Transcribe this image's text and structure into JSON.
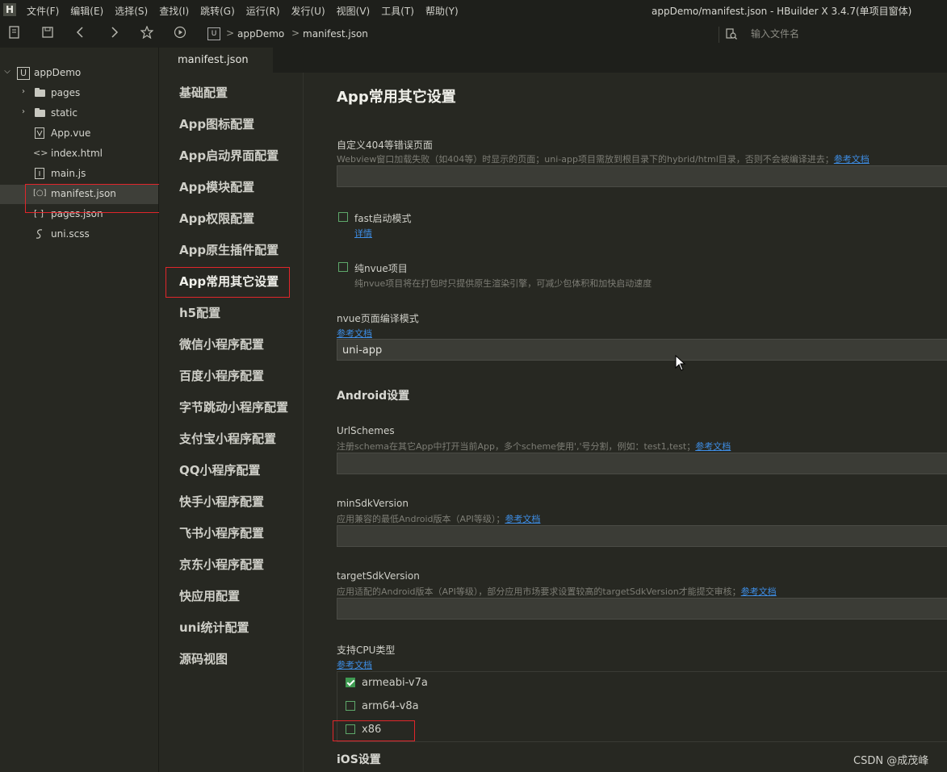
{
  "window": {
    "logo": "H",
    "title": "appDemo/manifest.json - HBuilder X 3.4.7(单项目窗体)"
  },
  "menu": [
    "文件(F)",
    "编辑(E)",
    "选择(S)",
    "查找(I)",
    "跳转(G)",
    "运行(R)",
    "发行(U)",
    "视图(V)",
    "工具(T)",
    "帮助(Y)"
  ],
  "toolbar": {
    "breadcrumb": {
      "badge": "U",
      "project": "appDemo",
      "separator": ">",
      "file": "manifest.json"
    },
    "file_search_placeholder": "输入文件名"
  },
  "tree": {
    "project": "appDemo",
    "items": [
      {
        "label": "pages",
        "type": "folder"
      },
      {
        "label": "static",
        "type": "folder"
      },
      {
        "label": "App.vue",
        "type": "vue"
      },
      {
        "label": "index.html",
        "type": "html"
      },
      {
        "label": "main.js",
        "type": "js"
      },
      {
        "label": "manifest.json",
        "type": "json",
        "selected": true
      },
      {
        "label": "pages.json",
        "type": "json"
      },
      {
        "label": "uni.scss",
        "type": "scss"
      }
    ]
  },
  "editor_tab": "manifest.json",
  "settings_nav": {
    "items": [
      "基础配置",
      "App图标配置",
      "App启动界面配置",
      "App模块配置",
      "App权限配置",
      "App原生插件配置",
      "App常用其它设置",
      "h5配置",
      "微信小程序配置",
      "百度小程序配置",
      "字节跳动小程序配置",
      "支付宝小程序配置",
      "QQ小程序配置",
      "快手小程序配置",
      "飞书小程序配置",
      "京东小程序配置",
      "快应用配置",
      "uni统计配置",
      "源码视图"
    ],
    "active_index": 6
  },
  "content": {
    "title": "App常用其它设置",
    "error_page": {
      "label": "自定义404等错误页面",
      "desc": "Webview窗口加载失败（如404等）时显示的页面；uni-app项目需放到根目录下的hybrid/html目录，否则不会被编译进去；",
      "link": "参考文档",
      "value": ""
    },
    "fast_start": {
      "label": "fast启动模式",
      "link": "详情",
      "checked": false
    },
    "pure_nvue": {
      "label": "纯nvue项目",
      "desc": "纯nvue项目将在打包时只提供原生渲染引擎，可减少包体积和加快启动速度",
      "checked": false
    },
    "nvue_mode": {
      "label": "nvue页面编译模式",
      "link": "参考文档",
      "value": "uni-app"
    },
    "android_heading": "Android设置",
    "url_schemes": {
      "label": "UrlSchemes",
      "desc": "注册schema在其它App中打开当前App，多个scheme使用','号分割，例如：test1,test；",
      "link": "参考文档",
      "value": ""
    },
    "min_sdk": {
      "label": "minSdkVersion",
      "desc": "应用兼容的最低Android版本（API等级）；",
      "link": "参考文档",
      "value": ""
    },
    "target_sdk": {
      "label": "targetSdkVersion",
      "desc": "应用适配的Android版本（API等级），部分应用市场要求设置较高的targetSdkVersion才能提交审核；",
      "link": "参考文档",
      "value": ""
    },
    "cpu": {
      "label": "支持CPU类型",
      "link": "参考文档",
      "options": [
        {
          "label": "armeabi-v7a",
          "checked": true
        },
        {
          "label": "arm64-v8a",
          "checked": false
        },
        {
          "label": "x86",
          "checked": false
        }
      ]
    },
    "ios_heading": "iOS设置"
  },
  "watermark": "CSDN @成茂峰",
  "colors": {
    "accent_link": "#3e8ee6",
    "highlight_box": "#e0262b",
    "checkbox_on": "#3f9a52",
    "background": "#272822"
  }
}
